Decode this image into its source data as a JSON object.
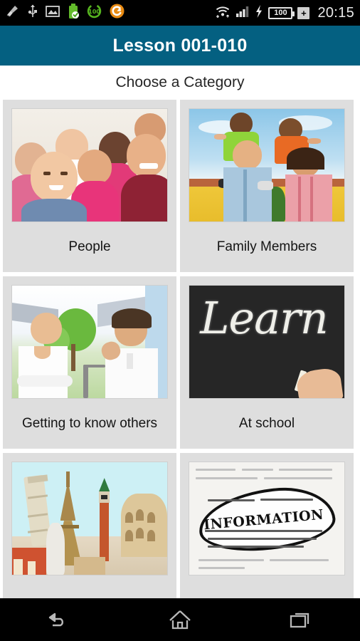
{
  "status_bar": {
    "time": "20:15",
    "battery_percent": "100",
    "plus_label": "+",
    "left_icons": [
      {
        "name": "cleaner-broom-icon"
      },
      {
        "name": "usb-icon"
      },
      {
        "name": "screenshot-image-icon"
      },
      {
        "name": "battery-full-check-icon"
      },
      {
        "name": "battery-percent-circle-icon",
        "label": "100"
      },
      {
        "name": "app-sync-orange-icon"
      }
    ],
    "right_icons": [
      {
        "name": "wifi-icon"
      },
      {
        "name": "cellular-signal-icon"
      },
      {
        "name": "charging-bolt-icon"
      },
      {
        "name": "battery-icon"
      },
      {
        "name": "battery-plus-icon"
      }
    ]
  },
  "action_bar": {
    "title": "Lesson 001-010",
    "background_color": "#046081"
  },
  "main": {
    "subtitle": "Choose a Category",
    "card_background": "#dedede",
    "page_background": "#ffffff",
    "categories": [
      {
        "label": "People",
        "image_name": "people-group-photo",
        "image_alt": "Group of smiling diverse young adults posed close together against a beige wall"
      },
      {
        "label": "Family Members",
        "image_name": "family-members-photo",
        "image_alt": "Smiling mother and father carrying two children on their shoulders outside a yellow house under a blue sky"
      },
      {
        "label": "Getting to know others",
        "image_name": "getting-to-know-others-photo",
        "image_alt": "A woman and a man in white shirts laughing together in a sunny garden"
      },
      {
        "label": "At school",
        "image_name": "at-school-chalkboard-photo",
        "image_alt": "Hand writing the word Learn in chalk on a black chalkboard",
        "chalk_word": "Learn"
      },
      {
        "label": "",
        "image_name": "travel-landmarks-photo",
        "image_alt": "Collage of European landmarks: Leaning Tower of Pisa, Eiffel Tower, St Mark's Campanile and the Colosseum on a pale blue sky"
      },
      {
        "label": "",
        "image_name": "information-glasses-photo",
        "image_alt": "Eyeglasses magnifying the word INFORMATION printed in a dictionary page",
        "info_word": "INFORMATION"
      }
    ]
  },
  "nav_bar": {
    "buttons": [
      {
        "name": "back-button"
      },
      {
        "name": "home-button"
      },
      {
        "name": "recent-apps-button"
      }
    ]
  }
}
